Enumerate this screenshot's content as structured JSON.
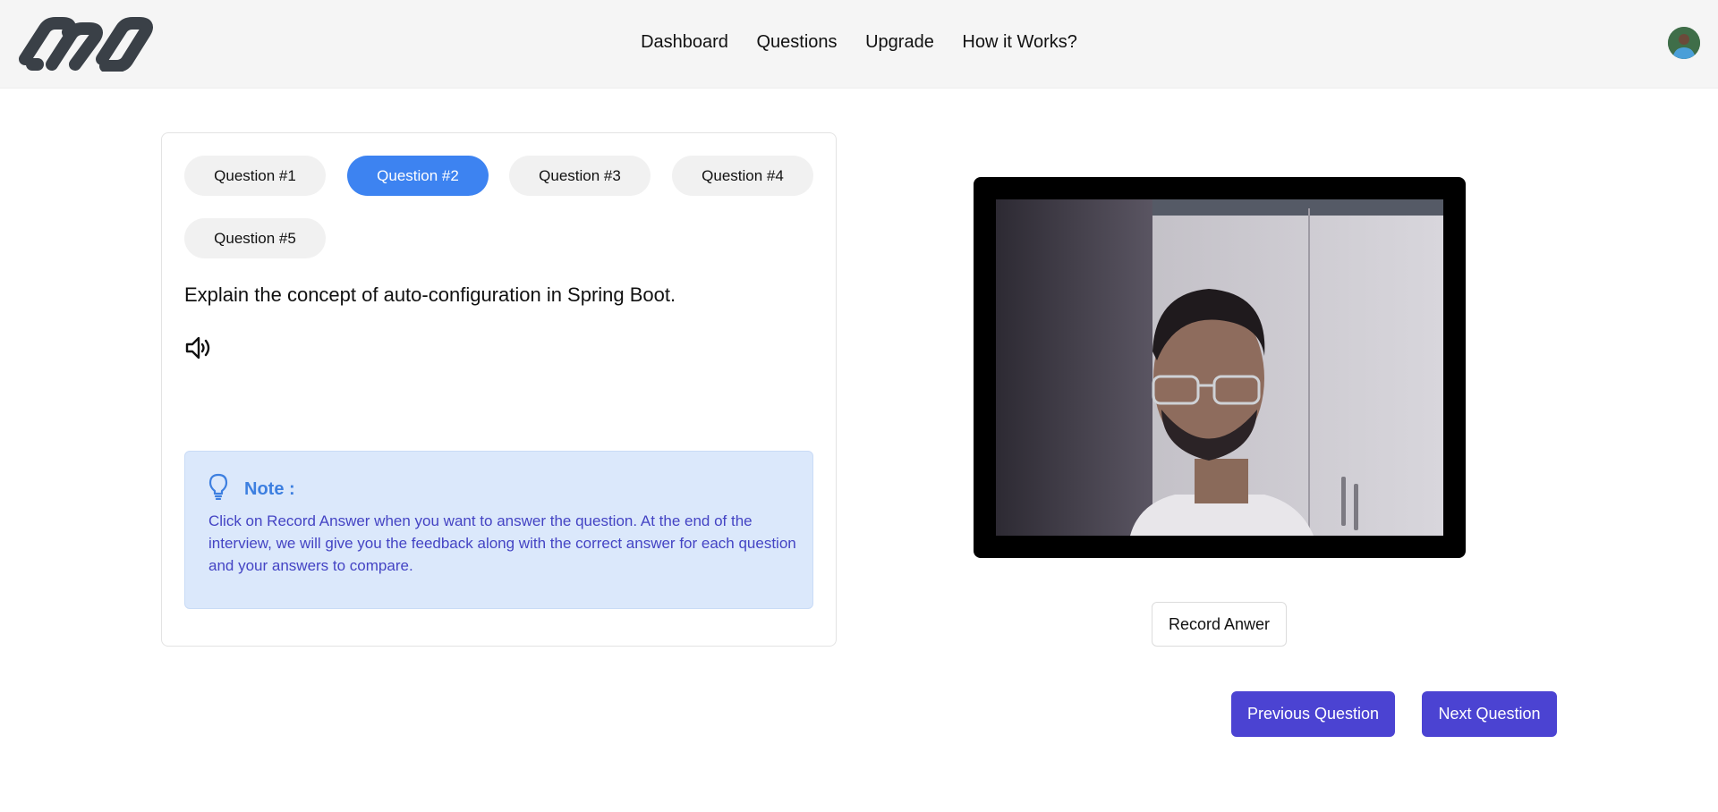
{
  "header": {
    "logo_icon": "infinity-chain-logo",
    "nav": [
      "Dashboard",
      "Questions",
      "Upgrade",
      "How it Works?"
    ],
    "avatar_icon": "user-avatar"
  },
  "questions": {
    "tabs": [
      "Question #1",
      "Question #2",
      "Question #3",
      "Question #4",
      "Question #5"
    ],
    "active_index": 1,
    "current_text": "Explain the concept of auto-configuration in Spring Boot.",
    "speaker_icon": "speaker-volume-icon"
  },
  "note": {
    "icon": "lightbulb-icon",
    "title": "Note :",
    "body": "Click on Record Answer when you want to answer the question. At the end of the interview, we will give you the feedback along with the correct answer for each question and your answers to compare."
  },
  "webcam": {
    "description_icon": "webcam-feed"
  },
  "actions": {
    "record": "Record Anwer",
    "previous": "Previous Question",
    "next": "Next Question"
  },
  "colors": {
    "accent_blue": "#3d83f1",
    "note_bg": "#dbe8fb",
    "note_text": "#4444c4",
    "primary_button": "#4b43d2"
  }
}
